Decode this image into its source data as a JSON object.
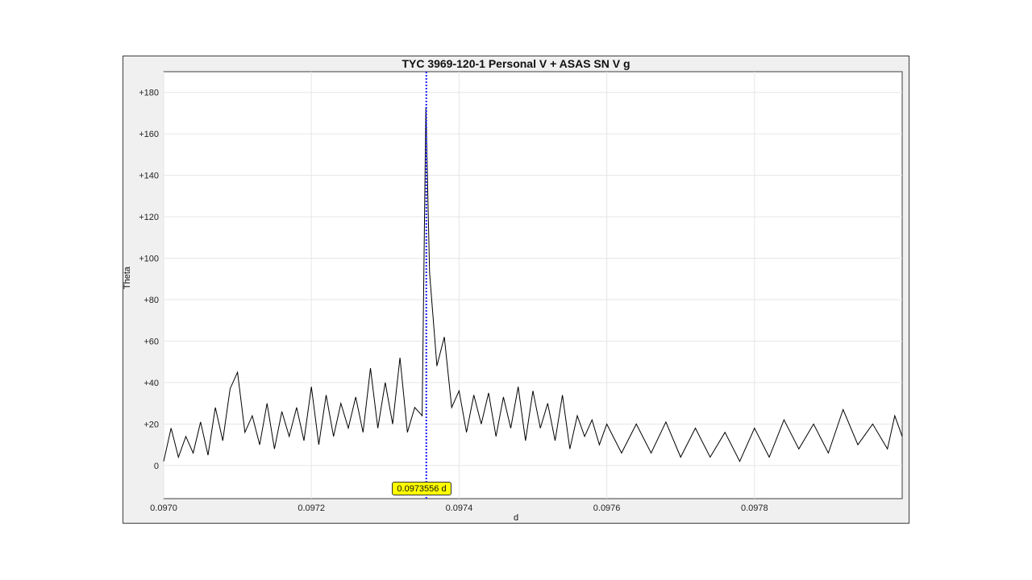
{
  "window": {
    "title": "TYC 3969-120-1 Personal V + ASAS SN V g"
  },
  "cursor": {
    "label": "0.0973556 d",
    "value": 0.0973556
  },
  "colors": {
    "series": "#000000",
    "cursor_line": "#1a1aff",
    "cursor_label_bg": "#ffff00",
    "grid": "#e6e6e6"
  },
  "chart_data": {
    "type": "line",
    "title": "TYC 3969-120-1 Personal V + ASAS SN V g",
    "xlabel": "d",
    "ylabel": "Theta",
    "xlim": [
      0.097,
      0.098
    ],
    "ylim": [
      -16,
      190
    ],
    "xticks": [
      0.097,
      0.0972,
      0.0974,
      0.0976,
      0.0978
    ],
    "xtick_labels": [
      "0.0970",
      "0.0972",
      "0.0974",
      "0.0976",
      "0.0978"
    ],
    "yticks": [
      0,
      20,
      40,
      60,
      80,
      100,
      120,
      140,
      160,
      180
    ],
    "ytick_labels": [
      "0",
      "+20",
      "+40",
      "+60",
      "+80",
      "+100",
      "+120",
      "+140",
      "+160",
      "+180"
    ],
    "grid": true,
    "legend": "none",
    "series": [
      {
        "x": [
          0.097,
          0.09701,
          0.09702,
          0.09703,
          0.09704,
          0.09705,
          0.09706,
          0.09707,
          0.09708,
          0.09709,
          0.0971,
          0.09711,
          0.09712,
          0.09713,
          0.09714,
          0.09715,
          0.09716,
          0.09717,
          0.09718,
          0.09719,
          0.0972,
          0.09721,
          0.09722,
          0.09723,
          0.09724,
          0.09725,
          0.09726,
          0.09727,
          0.09728,
          0.09729,
          0.0973,
          0.09731,
          0.09732,
          0.09733,
          0.09734,
          0.09735,
          0.097355,
          0.09736,
          0.09737,
          0.09738,
          0.09739,
          0.0974,
          0.09741,
          0.09742,
          0.09743,
          0.09744,
          0.09745,
          0.09746,
          0.09747,
          0.09748,
          0.09749,
          0.0975,
          0.09751,
          0.09752,
          0.09753,
          0.09754,
          0.09755,
          0.09756,
          0.09757,
          0.09758,
          0.09759,
          0.0976,
          0.09762,
          0.09764,
          0.09766,
          0.09768,
          0.0977,
          0.09772,
          0.09774,
          0.09776,
          0.09778,
          0.0978,
          0.09782,
          0.09784,
          0.09786,
          0.09788,
          0.0979,
          0.09792,
          0.09794,
          0.09796,
          0.09798,
          0.09799,
          0.098
        ],
        "y": [
          2,
          18,
          4,
          14,
          6,
          21,
          5,
          28,
          12,
          37,
          45,
          16,
          24,
          10,
          30,
          8,
          26,
          14,
          28,
          12,
          38,
          10,
          34,
          14,
          30,
          18,
          33,
          16,
          47,
          18,
          40,
          20,
          52,
          16,
          28,
          24,
          173,
          93,
          48,
          62,
          28,
          36,
          16,
          34,
          20,
          35,
          14,
          33,
          18,
          38,
          12,
          36,
          18,
          30,
          12,
          34,
          8,
          24,
          14,
          22,
          10,
          20,
          6,
          20,
          6,
          21,
          4,
          18,
          4,
          16,
          2,
          18,
          4,
          22,
          8,
          20,
          6,
          27,
          10,
          20,
          8,
          24,
          14
        ]
      }
    ]
  }
}
